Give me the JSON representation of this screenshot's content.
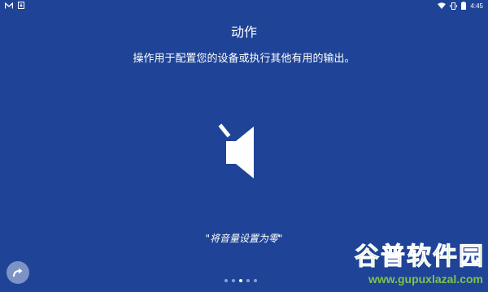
{
  "status_bar": {
    "left_icons": [
      "gmail-icon",
      "download-icon"
    ],
    "right_icons": [
      "wifi-icon",
      "vibrate-icon",
      "battery-icon"
    ],
    "time": "4:45"
  },
  "main": {
    "title": "动作",
    "subtitle": "操作用于配置您的设备或执行其他有用的输出。",
    "icon": "volume-mute-icon",
    "caption": "\"将音量设置为零\""
  },
  "controls": {
    "next_icon": "redo-arrow-icon",
    "page_indicator": {
      "total": 5,
      "active": 3
    }
  },
  "watermark": {
    "main": "谷普软件园",
    "sub": "www.gupuxlazal.com"
  },
  "colors": {
    "background": "#1f4497",
    "text": "#ffffff",
    "watermark": "#7fc34a"
  }
}
